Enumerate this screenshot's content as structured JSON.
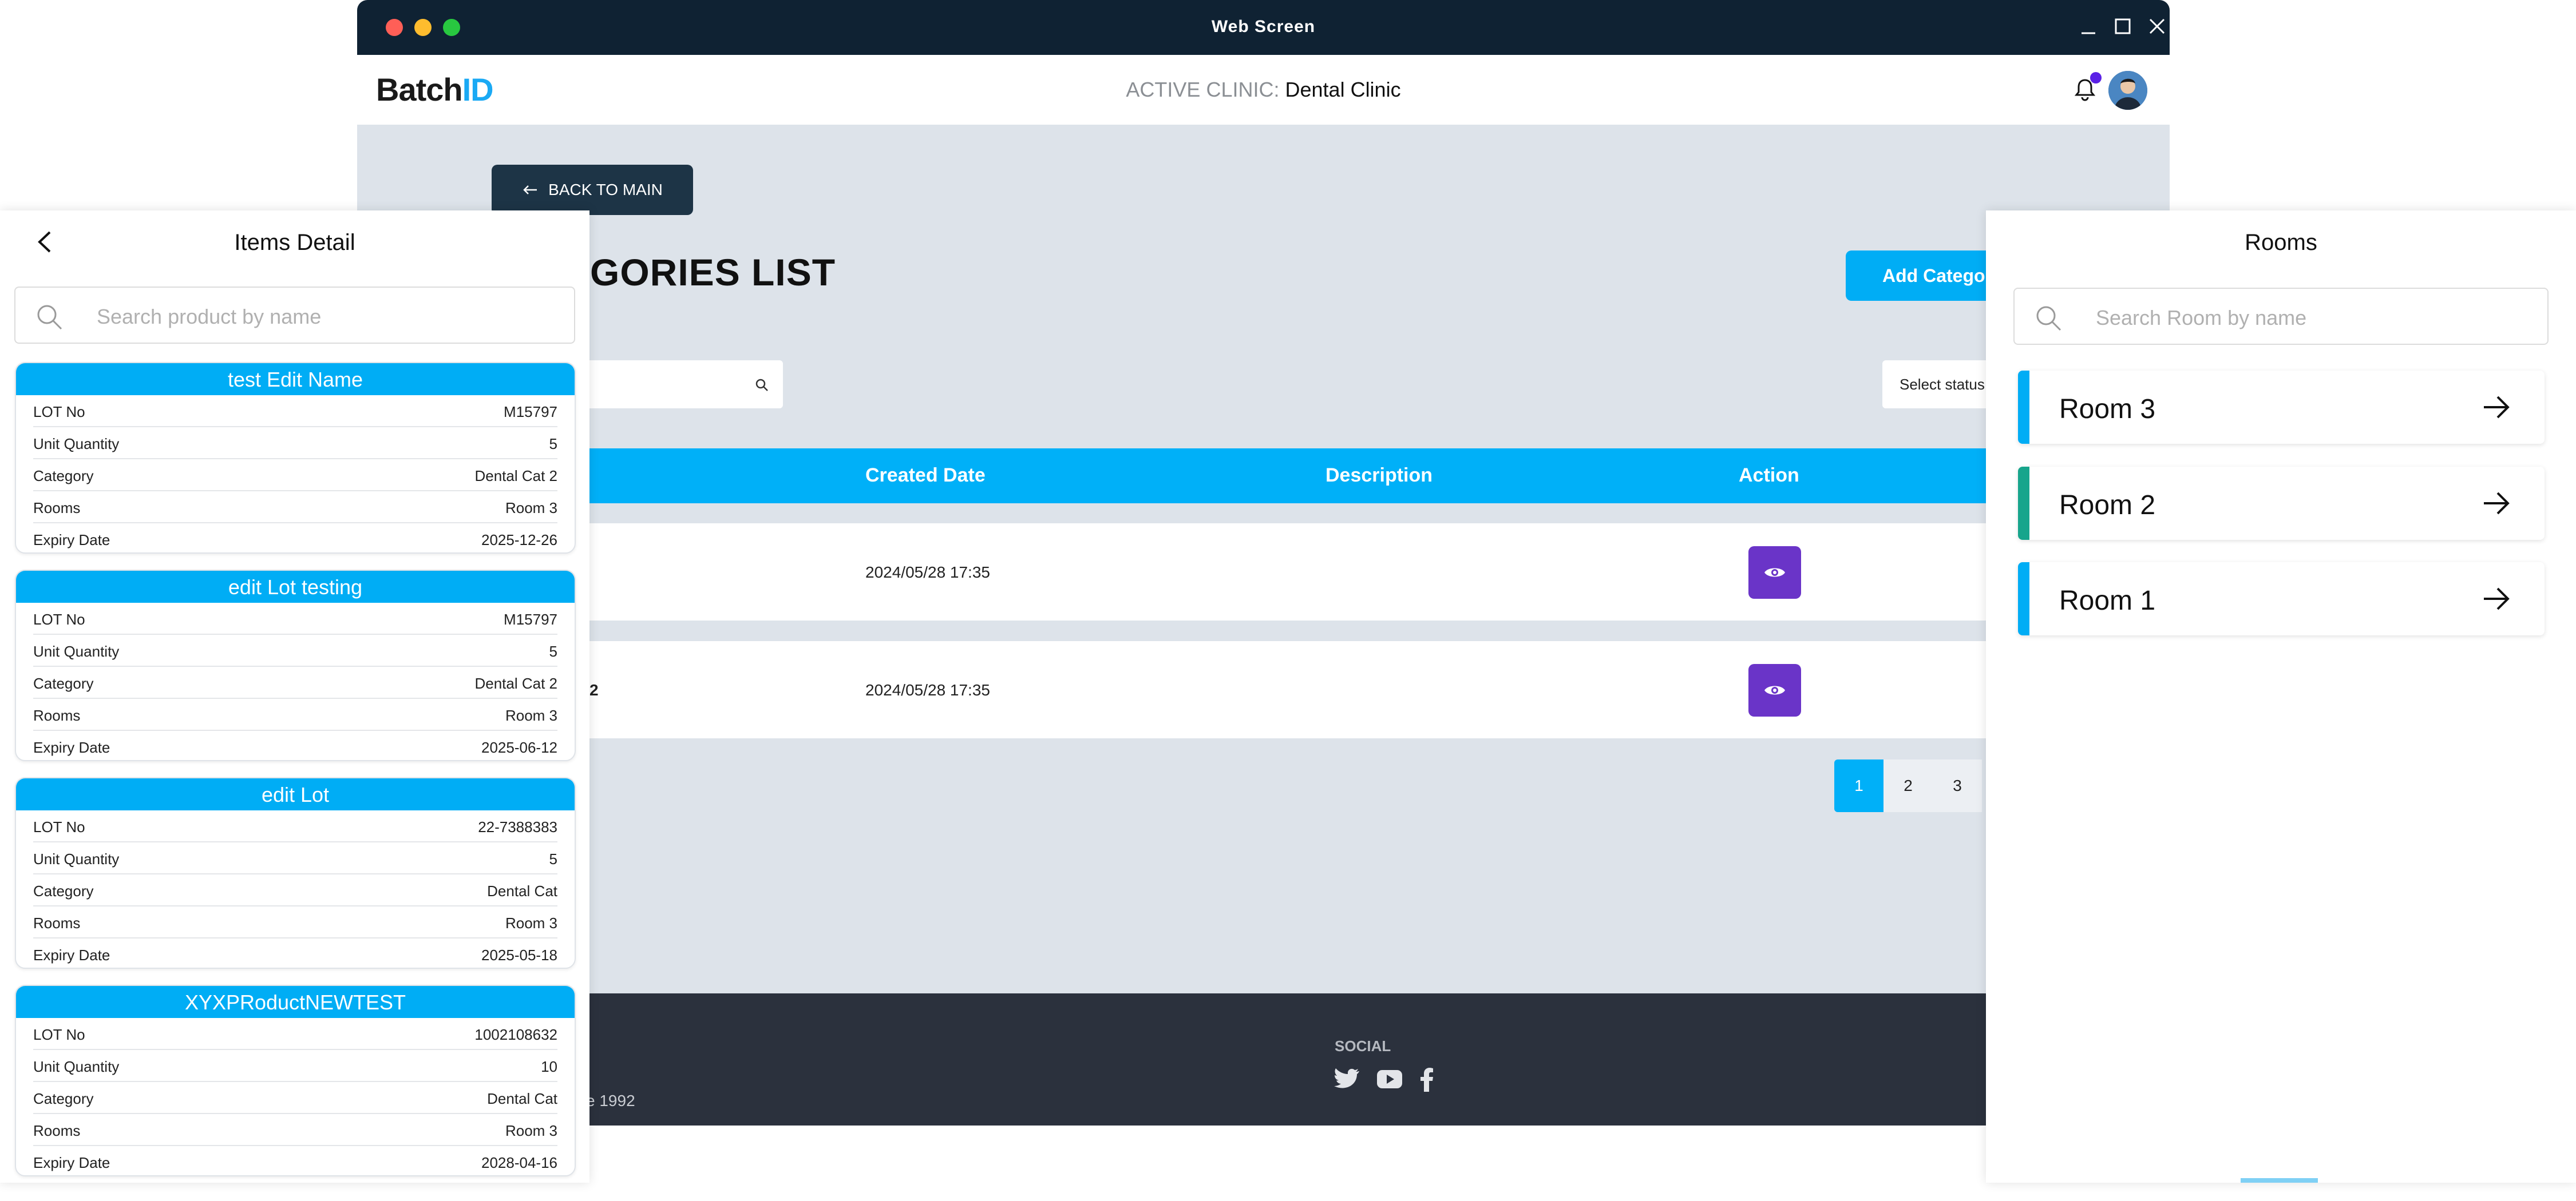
{
  "window": {
    "title": "Web Screen"
  },
  "topnav": {
    "logo_main": "Batch",
    "logo_accent": "ID",
    "clinic_label": "ACTIVE CLINIC:",
    "clinic_name": "Dental Clinic"
  },
  "content": {
    "back_label": "BACK TO MAIN",
    "heading": "GORIES LIST",
    "add_button": "Add Categor",
    "status_select": "Select status",
    "table": {
      "headers": [
        "Created Date",
        "Description",
        "Action"
      ],
      "rows": [
        {
          "name": "",
          "created": "2024/05/28 17:35",
          "description": ""
        },
        {
          "name": "2",
          "created": "2024/05/28 17:35",
          "description": ""
        }
      ]
    },
    "pagination": [
      "1",
      "2",
      "3"
    ]
  },
  "footer": {
    "social_label": "SOCIAL",
    "since_text": "e 1992"
  },
  "items_panel": {
    "title": "Items Detail",
    "search_placeholder": "Search product by name",
    "cards": [
      {
        "title": "test Edit Name",
        "rows": [
          [
            "LOT No",
            "M15797"
          ],
          [
            "Unit Quantity",
            "5"
          ],
          [
            "Category",
            "Dental Cat 2"
          ],
          [
            "Rooms",
            "Room 3"
          ],
          [
            "Expiry Date",
            "2025-12-26"
          ]
        ]
      },
      {
        "title": "edit Lot testing",
        "rows": [
          [
            "LOT No",
            "M15797"
          ],
          [
            "Unit Quantity",
            "5"
          ],
          [
            "Category",
            "Dental Cat 2"
          ],
          [
            "Rooms",
            "Room 3"
          ],
          [
            "Expiry Date",
            "2025-06-12"
          ]
        ]
      },
      {
        "title": "edit Lot",
        "rows": [
          [
            "LOT No",
            "22-7388383"
          ],
          [
            "Unit Quantity",
            "5"
          ],
          [
            "Category",
            "Dental Cat"
          ],
          [
            "Rooms",
            "Room 3"
          ],
          [
            "Expiry Date",
            "2025-05-18"
          ]
        ]
      },
      {
        "title": "XYXPRoductNEWTEST",
        "rows": [
          [
            "LOT No",
            "1002108632"
          ],
          [
            "Unit Quantity",
            "10"
          ],
          [
            "Category",
            "Dental Cat"
          ],
          [
            "Rooms",
            "Room 3"
          ],
          [
            "Expiry Date",
            "2028-04-16"
          ]
        ]
      }
    ]
  },
  "rooms_panel": {
    "title": "Rooms",
    "search_placeholder": "Search Room by name",
    "rooms": [
      {
        "name": "Room 3",
        "color": "#00adf5"
      },
      {
        "name": "Room 2",
        "color": "#17a58c"
      },
      {
        "name": "Room 1",
        "color": "#00adf5"
      }
    ]
  },
  "colors": {
    "accent": "#00adf5",
    "action": "#6a34c8",
    "titlebar": "#0f2233",
    "footer": "#2b313d"
  },
  "icons": [
    "close-icon",
    "minimize-icon",
    "maximize-icon",
    "bell-icon",
    "avatar",
    "arrow-left-icon",
    "search-icon",
    "eye-icon",
    "twitter-icon",
    "youtube-icon",
    "facebook-icon",
    "chevron-left-icon",
    "arrow-right-icon"
  ]
}
